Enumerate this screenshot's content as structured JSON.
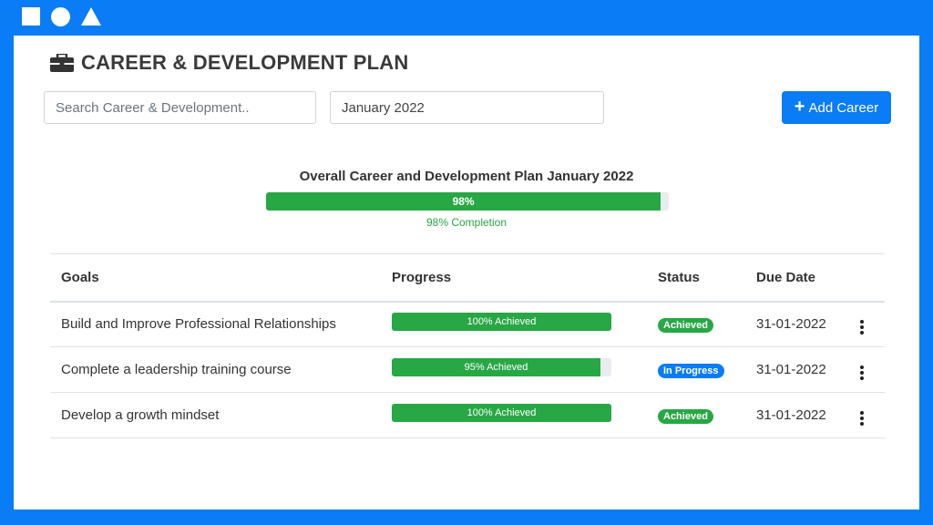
{
  "page": {
    "title": "CAREER & DEVELOPMENT PLAN",
    "title_icon": "briefcase-icon"
  },
  "toolbar": {
    "search_placeholder": "Search Career & Development..",
    "search_value": "",
    "month_value": "January 2022",
    "add_label": "Add Career",
    "add_icon": "plus-icon"
  },
  "overall": {
    "title": "Overall Career and Development Plan January 2022",
    "percent": 98,
    "bar_label": "98%",
    "caption": "98% Completion"
  },
  "table": {
    "headers": {
      "goals": "Goals",
      "progress": "Progress",
      "status": "Status",
      "due_date": "Due Date"
    },
    "rows": [
      {
        "goal": "Build and Improve Professional Relationships",
        "percent": 100,
        "progress_label": "100% Achieved",
        "status": "Achieved",
        "status_type": "achieved",
        "due_date": "31-01-2022"
      },
      {
        "goal": "Complete a leadership training course",
        "percent": 95,
        "progress_label": "95% Achieved",
        "status": "In Progress",
        "status_type": "progress",
        "due_date": "31-01-2022"
      },
      {
        "goal": "Develop a growth mindset",
        "percent": 100,
        "progress_label": "100% Achieved",
        "status": "Achieved",
        "status_type": "achieved",
        "due_date": "31-01-2022"
      }
    ]
  },
  "colors": {
    "frame": "#0a7cf5",
    "success": "#28a745",
    "primary": "#0a7cf5",
    "track": "#e9ecef"
  }
}
